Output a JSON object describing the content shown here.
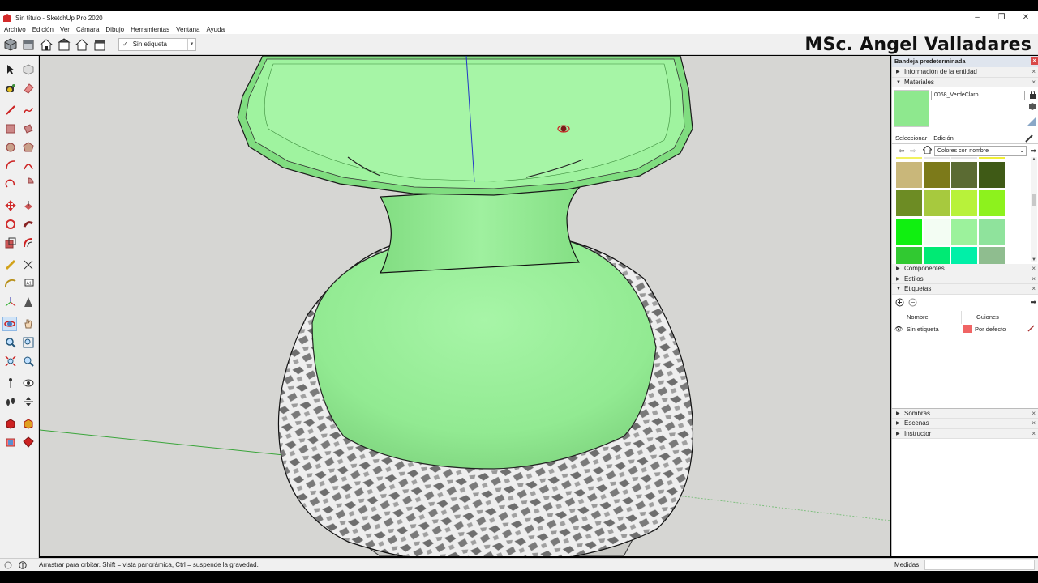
{
  "window": {
    "title": "Sin título - SketchUp Pro 2020",
    "minimize": "–",
    "restore": "❐",
    "close": "✕"
  },
  "menu": [
    "Archivo",
    "Edición",
    "Ver",
    "Cámara",
    "Dibujo",
    "Herramientas",
    "Ventana",
    "Ayuda"
  ],
  "toolbar": {
    "tag_check": "✓",
    "tag_value": "Sin etiqueta"
  },
  "watermark": "MSc. Angel Valladares",
  "tray": {
    "title": "Bandeja predeterminada",
    "entity_info": "Información de la entidad",
    "materials": "Materiales",
    "material_name": "0068_VerdeClaro",
    "tab_select": "Seleccionar",
    "tab_edit": "Edición",
    "library": "Colores con nombre",
    "components": "Componentes",
    "styles": "Estilos",
    "tags": "Etiquetas",
    "tag_col_name": "Nombre",
    "tag_col_dashes": "Guiones",
    "tag_row_name": "Sin etiqueta",
    "tag_row_dash": "Por defecto",
    "shadows": "Sombras",
    "scenes": "Escenas",
    "instructor": "Instructor"
  },
  "swatch_colors": [
    [
      "#f2f25e",
      "#e9e9e9",
      "#e6e6e6",
      "#f1ef35"
    ],
    [
      "#c9b77a",
      "#7c7a1a",
      "#5b6b33",
      "#3f5a16"
    ],
    [
      "#6d8c24",
      "#a7c93e",
      "#b8f23a",
      "#8df21d"
    ],
    [
      "#10f010",
      "#f3fdf3",
      "#9cf29c",
      "#8fe39c"
    ],
    [
      "#31c931",
      "#00ea74",
      "#00f0a8",
      "#8fbd8f"
    ]
  ],
  "accent": {
    "material": "#8ee88e",
    "tag_color": "#f06464",
    "close_red": "#d94848"
  },
  "status": {
    "message": "Arrastrar para orbitar. Shift = vista panorámica, Ctrl = suspende la gravedad.",
    "measure_label": "Medidas"
  }
}
